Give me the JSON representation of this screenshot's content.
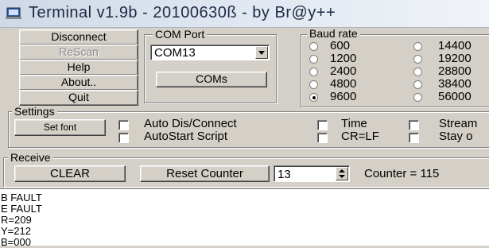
{
  "window": {
    "title": "Terminal v1.9b - 20100630ß - by Br@y++"
  },
  "left_buttons": {
    "disconnect": "Disconnect",
    "rescan": "ReScan",
    "help": "Help",
    "about": "About..",
    "quit": "Quit"
  },
  "com_port": {
    "label": "COM Port",
    "selected": "COM13",
    "coms_button": "COMs"
  },
  "baud_rate": {
    "label": "Baud rate",
    "options": [
      "600",
      "1200",
      "2400",
      "4800",
      "9600",
      "14400",
      "19200",
      "28800",
      "38400",
      "56000"
    ],
    "selected": "9600"
  },
  "settings": {
    "label": "Settings",
    "set_font": "Set font",
    "checkboxes": [
      "Auto Dis/Connect",
      "AutoStart Script",
      "Time",
      "CR=LF",
      "Stream",
      "Stay o"
    ]
  },
  "receive": {
    "label": "Receive",
    "clear": "CLEAR",
    "reset_counter": "Reset Counter",
    "counter_spin_value": "13",
    "counter_text": "Counter = 115"
  },
  "terminal_lines": [
    "B FAULT",
    "E FAULT",
    "R=209",
    "Y=212",
    "B=000"
  ]
}
